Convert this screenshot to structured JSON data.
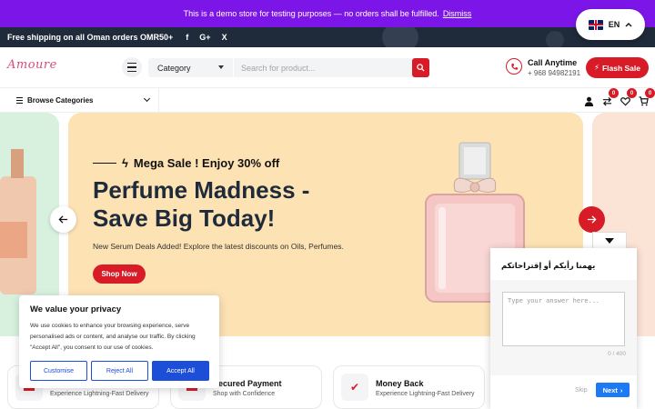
{
  "demo_notice": {
    "text": "This is a demo store for testing purposes — no orders shall be fulfilled.",
    "dismiss_label": "Dismiss"
  },
  "language": {
    "code": "EN"
  },
  "topbar": {
    "shipping_text": "Free shipping on all Oman orders OMR50+",
    "socials": [
      "f",
      "G+",
      "X"
    ]
  },
  "header": {
    "logo_text": "Amoure",
    "category_label": "Category",
    "search_placeholder": "Search for product...",
    "call_label": "Call Anytime",
    "call_number": "+ 968 94982191",
    "flash_sale_label": "Flash Sale"
  },
  "navbar": {
    "browse_label": "Browse Categories",
    "compare_count": "0",
    "wishlist_count": "0",
    "cart_count": "0"
  },
  "hero": {
    "kicker": "Mega Sale ! Enjoy 30% off",
    "title": "Perfume Madness - Save Big Today!",
    "description": "New Serum Deals Added! Explore the latest discounts on Oils, Perfumes.",
    "cta_label": "Shop Now"
  },
  "features": [
    {
      "title": "",
      "subtitle": "Experience Lightning-Fast Delivery"
    },
    {
      "title": "Secured Payment",
      "subtitle": "Shop with Confidence"
    },
    {
      "title": "Money Back",
      "subtitle": "Experience Lightning-Fast Delivery"
    }
  ],
  "cookie": {
    "title": "We value your privacy",
    "body": "We use cookies to enhance your browsing experience, serve personalised ads or content, and analyse our traffic. By clicking \"Accept All\", you consent to our use of cookies.",
    "customise_label": "Customise",
    "reject_label": "Reject All",
    "accept_label": "Accept All"
  },
  "survey": {
    "question": "يهمنا رأيكم أو إقتراحاتكم",
    "placeholder": "Type your answer here...",
    "counter": "0 / 400",
    "skip_label": "Skip",
    "next_label": "Next"
  },
  "colors": {
    "accent": "#d71c28",
    "demo_bar": "#7c16e8",
    "topbar": "#1f2a3a",
    "hero_bg": "#fde2b4",
    "cookie_blue": "#1d4ed8"
  }
}
